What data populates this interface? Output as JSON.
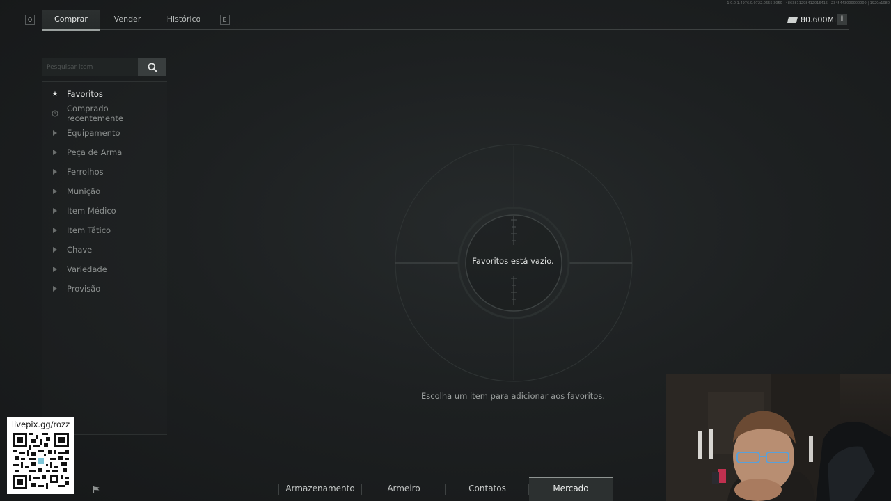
{
  "header": {
    "key_left": "Q",
    "key_right": "E",
    "tabs": [
      {
        "label": "Comprar",
        "active": true
      },
      {
        "label": "Vender",
        "active": false
      },
      {
        "label": "Histórico",
        "active": false
      }
    ],
    "version_text": "1.0.0.1.4976.0.0722.0655.3050 · 4863811298412016415 · 2345443000000000 | 1920x1080",
    "balance": "80.600Mil",
    "balance_icon": "cash-icon",
    "info_label": "i"
  },
  "sidebar": {
    "search_placeholder": "Pesquisar item",
    "search_icon": "search-icon",
    "categories": [
      {
        "label": "Favoritos",
        "icon": "star-icon",
        "active": true
      },
      {
        "label": "Comprado recentemente",
        "icon": "clock-icon",
        "active": false
      },
      {
        "label": "Equipamento",
        "icon": "expand-arrow-icon",
        "active": false
      },
      {
        "label": "Peça de Arma",
        "icon": "expand-arrow-icon",
        "active": false
      },
      {
        "label": "Ferrolhos",
        "icon": "expand-arrow-icon",
        "active": false
      },
      {
        "label": "Munição",
        "icon": "expand-arrow-icon",
        "active": false
      },
      {
        "label": "Item Médico",
        "icon": "expand-arrow-icon",
        "active": false
      },
      {
        "label": "Item Tático",
        "icon": "expand-arrow-icon",
        "active": false
      },
      {
        "label": "Chave",
        "icon": "expand-arrow-icon",
        "active": false
      },
      {
        "label": "Variedade",
        "icon": "expand-arrow-icon",
        "active": false
      },
      {
        "label": "Provisão",
        "icon": "expand-arrow-icon",
        "active": false
      }
    ]
  },
  "main": {
    "empty_title": "Favoritos está vazio.",
    "empty_hint": "Escolha um item para adicionar aos favoritos."
  },
  "bottom_nav": [
    {
      "label": "Armazenamento",
      "active": false
    },
    {
      "label": "Armeiro",
      "active": false
    },
    {
      "label": "Contatos",
      "active": false
    },
    {
      "label": "Mercado",
      "active": true
    }
  ],
  "overlay": {
    "qr_label": "livepix.gg/rozz"
  },
  "colors": {
    "background": "#1d2021",
    "accent": "#9aa09e",
    "active_text": "#e6e8e7"
  }
}
